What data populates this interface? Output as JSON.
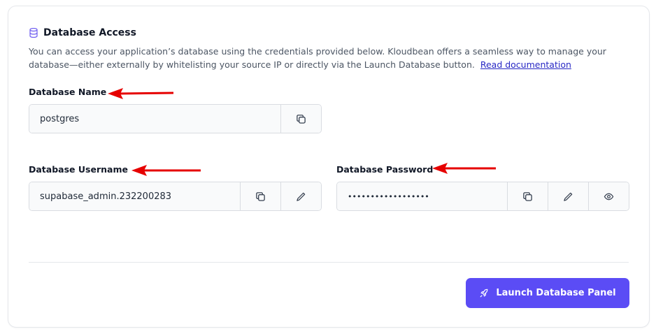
{
  "section": {
    "title": "Database Access",
    "description": "You can access your application’s database using the credentials provided below. Kloudbean offers a seamless way to manage your database—either externally by whitelisting your source IP or directly via the Launch Database button.",
    "doc_link": "Read documentation"
  },
  "fields": {
    "db_name": {
      "label": "Database Name",
      "value": "postgres"
    },
    "db_username": {
      "label": "Database Username",
      "value": "supabase_admin.232200283"
    },
    "db_password": {
      "label": "Database Password",
      "value": "••••••••••••••••••"
    }
  },
  "actions": {
    "launch_label": "Launch Database Panel"
  },
  "colors": {
    "accent": "#5b4cf5",
    "annotation_arrow": "#e60000",
    "link": "#2727c4"
  },
  "icons": [
    "database-icon",
    "copy-icon",
    "pencil-icon",
    "eye-icon",
    "rocket-icon",
    "arrow-annotation"
  ]
}
